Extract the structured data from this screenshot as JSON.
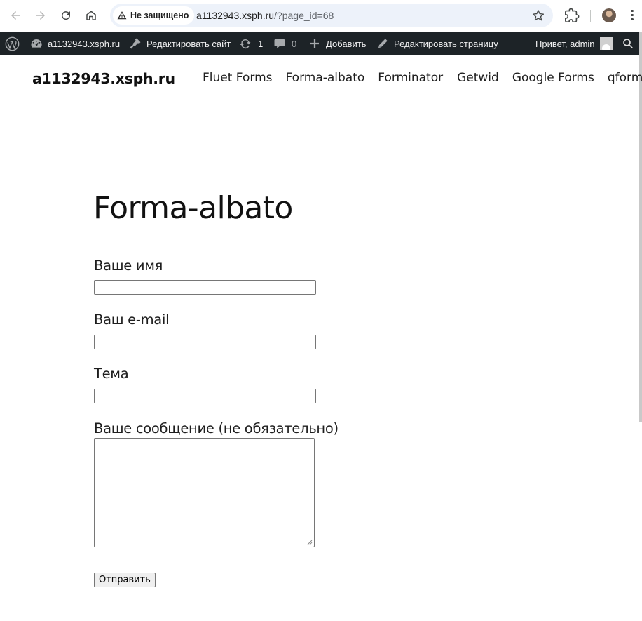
{
  "browser": {
    "security_label": "Не защищено",
    "url_host": "a1132943.xsph.ru",
    "url_path": "/?page_id=68"
  },
  "adminbar": {
    "site_name": "a1132943.xsph.ru",
    "customize": "Редактировать сайт",
    "updates_count": "1",
    "comments_count": "0",
    "new_content": "Добавить",
    "edit_page": "Редактировать страницу",
    "greeting": "Привет, admin"
  },
  "site": {
    "title": "a1132943.xsph.ru",
    "nav": [
      "Fluet Forms",
      "Forma-albato",
      "Forminator",
      "Getwid",
      "Google Forms",
      "qform"
    ]
  },
  "page": {
    "title": "Forma-albato",
    "form": {
      "name_label": "Ваше имя",
      "email_label": "Ваш e-mail",
      "subject_label": "Тема",
      "message_label": "Ваше сообщение (не обязательно)",
      "submit_label": "Отправить"
    }
  }
}
